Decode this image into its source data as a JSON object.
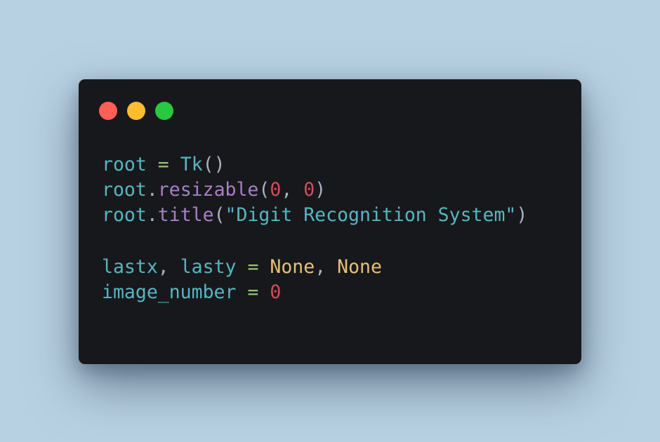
{
  "window": {
    "controls": {
      "close": "close-dot",
      "minimize": "minimize-dot",
      "maximize": "maximize-dot"
    },
    "colors": {
      "background": "#17181b",
      "close": "#ff5f57",
      "minimize": "#febc2e",
      "maximize": "#28c840"
    }
  },
  "code": {
    "line1": {
      "t1": "root",
      "t2": " ",
      "t3": "=",
      "t4": " ",
      "t5": "Tk",
      "t6": "()"
    },
    "line2": {
      "t1": "root",
      "t2": ".",
      "t3": "resizable",
      "t4": "(",
      "t5": "0",
      "t6": ", ",
      "t7": "0",
      "t8": ")"
    },
    "line3": {
      "t1": "root",
      "t2": ".",
      "t3": "title",
      "t4": "(",
      "t5": "\"Digit Recognition System\"",
      "t6": ")"
    },
    "line4": {
      "t1": "lastx",
      "t2": ", ",
      "t3": "lasty",
      "t4": " ",
      "t5": "=",
      "t6": " ",
      "t7": "None",
      "t8": ", ",
      "t9": "None"
    },
    "line5": {
      "t1": "image_number",
      "t2": " ",
      "t3": "=",
      "t4": " ",
      "t5": "0"
    }
  }
}
